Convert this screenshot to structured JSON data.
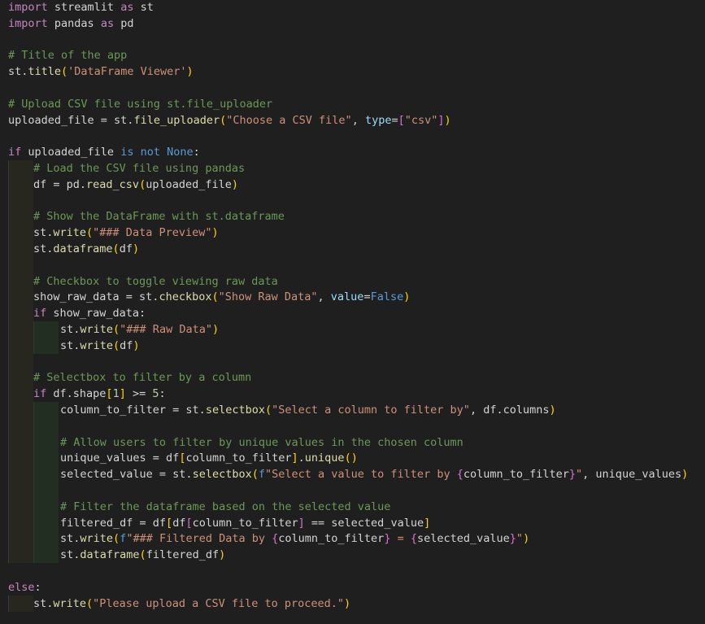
{
  "editor": {
    "language": "python",
    "theme": "dark",
    "lines": [
      {
        "indent": 0,
        "tokens": [
          [
            "kw",
            "import"
          ],
          [
            "tx",
            " streamlit "
          ],
          [
            "kw",
            "as"
          ],
          [
            "tx",
            " st"
          ]
        ]
      },
      {
        "indent": 0,
        "tokens": [
          [
            "kw",
            "import"
          ],
          [
            "tx",
            " pandas "
          ],
          [
            "kw",
            "as"
          ],
          [
            "tx",
            " pd"
          ]
        ]
      },
      {
        "indent": 0,
        "tokens": []
      },
      {
        "indent": 0,
        "tokens": [
          [
            "cm",
            "# Title of the app"
          ]
        ]
      },
      {
        "indent": 0,
        "tokens": [
          [
            "tx",
            "st."
          ],
          [
            "fn",
            "title"
          ],
          [
            "br1",
            "("
          ],
          [
            "st",
            "'DataFrame Viewer'"
          ],
          [
            "br1",
            ")"
          ]
        ]
      },
      {
        "indent": 0,
        "tokens": []
      },
      {
        "indent": 0,
        "tokens": [
          [
            "cm",
            "# Upload CSV file using st.file_uploader"
          ]
        ]
      },
      {
        "indent": 0,
        "tokens": [
          [
            "tx",
            "uploaded_file = st."
          ],
          [
            "fn",
            "file_uploader"
          ],
          [
            "br1",
            "("
          ],
          [
            "st",
            "\"Choose a CSV file\""
          ],
          [
            "tx",
            ", "
          ],
          [
            "vr",
            "type"
          ],
          [
            "tx",
            "="
          ],
          [
            "br2",
            "["
          ],
          [
            "st",
            "\"csv\""
          ],
          [
            "br2",
            "]"
          ],
          [
            "br1",
            ")"
          ]
        ]
      },
      {
        "indent": 0,
        "tokens": []
      },
      {
        "indent": 0,
        "tokens": [
          [
            "kw",
            "if"
          ],
          [
            "tx",
            " uploaded_file "
          ],
          [
            "kb",
            "is not"
          ],
          [
            "tx",
            " "
          ],
          [
            "kb",
            "None"
          ],
          [
            "tx",
            ":"
          ]
        ]
      },
      {
        "indent": 1,
        "tokens": [
          [
            "cm",
            "# Load the CSV file using pandas"
          ]
        ]
      },
      {
        "indent": 1,
        "tokens": [
          [
            "tx",
            "df = pd."
          ],
          [
            "fn",
            "read_csv"
          ],
          [
            "br1",
            "("
          ],
          [
            "tx",
            "uploaded_file"
          ],
          [
            "br1",
            ")"
          ]
        ]
      },
      {
        "indent": 1,
        "tokens": []
      },
      {
        "indent": 1,
        "tokens": [
          [
            "cm",
            "# Show the DataFrame with st.dataframe"
          ]
        ]
      },
      {
        "indent": 1,
        "tokens": [
          [
            "tx",
            "st."
          ],
          [
            "fn",
            "write"
          ],
          [
            "br1",
            "("
          ],
          [
            "st",
            "\"### Data Preview\""
          ],
          [
            "br1",
            ")"
          ]
        ]
      },
      {
        "indent": 1,
        "tokens": [
          [
            "tx",
            "st."
          ],
          [
            "fn",
            "dataframe"
          ],
          [
            "br1",
            "("
          ],
          [
            "tx",
            "df"
          ],
          [
            "br1",
            ")"
          ]
        ]
      },
      {
        "indent": 1,
        "tokens": []
      },
      {
        "indent": 1,
        "tokens": [
          [
            "cm",
            "# Checkbox to toggle viewing raw data"
          ]
        ]
      },
      {
        "indent": 1,
        "tokens": [
          [
            "tx",
            "show_raw_data = st."
          ],
          [
            "fn",
            "checkbox"
          ],
          [
            "br1",
            "("
          ],
          [
            "st",
            "\"Show Raw Data\""
          ],
          [
            "tx",
            ", "
          ],
          [
            "vr",
            "value"
          ],
          [
            "tx",
            "="
          ],
          [
            "kb",
            "False"
          ],
          [
            "br1",
            ")"
          ]
        ]
      },
      {
        "indent": 1,
        "tokens": [
          [
            "kw",
            "if"
          ],
          [
            "tx",
            " show_raw_data:"
          ]
        ]
      },
      {
        "indent": 2,
        "tokens": [
          [
            "tx",
            "st."
          ],
          [
            "fn",
            "write"
          ],
          [
            "br1",
            "("
          ],
          [
            "st",
            "\"### Raw Data\""
          ],
          [
            "br1",
            ")"
          ]
        ]
      },
      {
        "indent": 2,
        "tokens": [
          [
            "tx",
            "st."
          ],
          [
            "fn",
            "write"
          ],
          [
            "br1",
            "("
          ],
          [
            "tx",
            "df"
          ],
          [
            "br1",
            ")"
          ]
        ]
      },
      {
        "indent": 1,
        "tokens": []
      },
      {
        "indent": 1,
        "tokens": [
          [
            "cm",
            "# Selectbox to filter by a column"
          ]
        ]
      },
      {
        "indent": 1,
        "tokens": [
          [
            "kw",
            "if"
          ],
          [
            "tx",
            " df.shape"
          ],
          [
            "br1",
            "["
          ],
          [
            "nm",
            "1"
          ],
          [
            "br1",
            "]"
          ],
          [
            "tx",
            " >= "
          ],
          [
            "nm",
            "5"
          ],
          [
            "tx",
            ":"
          ]
        ]
      },
      {
        "indent": 2,
        "tokens": [
          [
            "tx",
            "column_to_filter = st."
          ],
          [
            "fn",
            "selectbox"
          ],
          [
            "br1",
            "("
          ],
          [
            "st",
            "\"Select a column to filter by\""
          ],
          [
            "tx",
            ", df.columns"
          ],
          [
            "br1",
            ")"
          ]
        ]
      },
      {
        "indent": 2,
        "tokens": []
      },
      {
        "indent": 2,
        "tokens": [
          [
            "cm",
            "# Allow users to filter by unique values in the chosen column"
          ]
        ]
      },
      {
        "indent": 2,
        "tokens": [
          [
            "tx",
            "unique_values = df"
          ],
          [
            "br1",
            "["
          ],
          [
            "tx",
            "column_to_filter"
          ],
          [
            "br1",
            "]"
          ],
          [
            "tx",
            "."
          ],
          [
            "fn",
            "unique"
          ],
          [
            "br1",
            "()"
          ]
        ]
      },
      {
        "indent": 2,
        "tokens": [
          [
            "tx",
            "selected_value = st."
          ],
          [
            "fn",
            "selectbox"
          ],
          [
            "br1",
            "("
          ],
          [
            "kb",
            "f"
          ],
          [
            "st",
            "\"Select a value to filter by "
          ],
          [
            "br2",
            "{"
          ],
          [
            "tx",
            "column_to_filter"
          ],
          [
            "br2",
            "}"
          ],
          [
            "st",
            "\""
          ],
          [
            "tx",
            ", unique_values"
          ],
          [
            "br1",
            ")"
          ]
        ]
      },
      {
        "indent": 2,
        "tokens": []
      },
      {
        "indent": 2,
        "tokens": [
          [
            "cm",
            "# Filter the dataframe based on the selected value"
          ]
        ]
      },
      {
        "indent": 2,
        "tokens": [
          [
            "tx",
            "filtered_df = df"
          ],
          [
            "br1",
            "["
          ],
          [
            "tx",
            "df"
          ],
          [
            "br2",
            "["
          ],
          [
            "tx",
            "column_to_filter"
          ],
          [
            "br2",
            "]"
          ],
          [
            "tx",
            " == selected_value"
          ],
          [
            "br1",
            "]"
          ]
        ]
      },
      {
        "indent": 2,
        "tokens": [
          [
            "tx",
            "st."
          ],
          [
            "fn",
            "write"
          ],
          [
            "br1",
            "("
          ],
          [
            "kb",
            "f"
          ],
          [
            "st",
            "\"### Filtered Data by "
          ],
          [
            "br2",
            "{"
          ],
          [
            "tx",
            "column_to_filter"
          ],
          [
            "br2",
            "}"
          ],
          [
            "st",
            " = "
          ],
          [
            "br2",
            "{"
          ],
          [
            "tx",
            "selected_value"
          ],
          [
            "br2",
            "}"
          ],
          [
            "st",
            "\""
          ],
          [
            "br1",
            ")"
          ]
        ]
      },
      {
        "indent": 2,
        "tokens": [
          [
            "tx",
            "st."
          ],
          [
            "fn",
            "dataframe"
          ],
          [
            "br1",
            "("
          ],
          [
            "tx",
            "filtered_df"
          ],
          [
            "br1",
            ")"
          ]
        ]
      },
      {
        "indent": 0,
        "tokens": []
      },
      {
        "indent": 0,
        "tokens": [
          [
            "kw",
            "else"
          ],
          [
            "tx",
            ":"
          ]
        ]
      },
      {
        "indent": 1,
        "tokens": [
          [
            "tx",
            "st."
          ],
          [
            "fn",
            "write"
          ],
          [
            "br1",
            "("
          ],
          [
            "st",
            "\"Please upload a CSV file to proceed.\""
          ],
          [
            "br1",
            ")"
          ]
        ]
      }
    ]
  }
}
